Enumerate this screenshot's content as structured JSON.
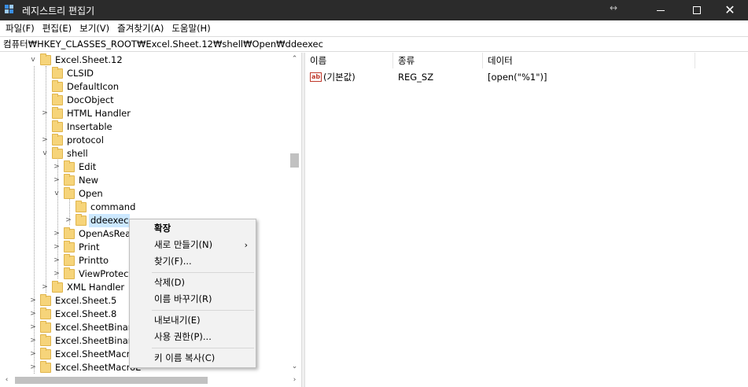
{
  "window": {
    "title": "레지스트리 편집기",
    "resize_glyph": "↔",
    "close_glyph": "✕"
  },
  "menubar": {
    "items": [
      "파일(F)",
      "편집(E)",
      "보기(V)",
      "즐겨찾기(A)",
      "도움말(H)"
    ]
  },
  "address": {
    "path": "컴퓨터₩HKEY_CLASSES_ROOT₩Excel.Sheet.12₩shell₩Open₩ddeexec"
  },
  "tree": {
    "chev_expanded": "v",
    "chev_collapsed": ">",
    "nodes": [
      {
        "label": "Excel.Sheet.12",
        "state": "expanded"
      },
      {
        "label": "CLSID",
        "state": "leaf"
      },
      {
        "label": "DefaultIcon",
        "state": "leaf"
      },
      {
        "label": "DocObject",
        "state": "leaf"
      },
      {
        "label": "HTML Handler",
        "state": "collapsed"
      },
      {
        "label": "Insertable",
        "state": "leaf"
      },
      {
        "label": "protocol",
        "state": "collapsed"
      },
      {
        "label": "shell",
        "state": "expanded"
      },
      {
        "label": "Edit",
        "state": "collapsed"
      },
      {
        "label": "New",
        "state": "collapsed"
      },
      {
        "label": "Open",
        "state": "expanded"
      },
      {
        "label": "command",
        "state": "leaf"
      },
      {
        "label": "ddeexec",
        "state": "collapsed",
        "selected": true
      },
      {
        "label": "OpenAsRead",
        "state": "collapsed"
      },
      {
        "label": "Print",
        "state": "collapsed"
      },
      {
        "label": "Printto",
        "state": "collapsed"
      },
      {
        "label": "ViewProtecte",
        "state": "collapsed"
      },
      {
        "label": "XML Handler",
        "state": "collapsed"
      },
      {
        "label": "Excel.Sheet.5",
        "state": "collapsed"
      },
      {
        "label": "Excel.Sheet.8",
        "state": "collapsed"
      },
      {
        "label": "Excel.SheetBinaryN",
        "state": "collapsed"
      },
      {
        "label": "Excel.SheetBinaryN",
        "state": "collapsed"
      },
      {
        "label": "Excel.SheetMacroE",
        "state": "collapsed"
      },
      {
        "label": "Excel.SheetMacroE",
        "state": "collapsed"
      }
    ]
  },
  "list": {
    "headers": [
      "이름",
      "종류",
      "데이터"
    ],
    "rows": [
      {
        "icon": "ab",
        "name": "(기본값)",
        "type": "REG_SZ",
        "data": "[open(\"%1\")]"
      }
    ]
  },
  "context_menu": {
    "items": [
      {
        "label": "확장",
        "bold": true
      },
      {
        "label": "새로 만들기(N)",
        "submenu": true,
        "arrow": "›"
      },
      {
        "label": "찾기(F)..."
      },
      {
        "label": "삭제(D)"
      },
      {
        "label": "이름 바꾸기(R)"
      },
      {
        "label": "내보내기(E)"
      },
      {
        "label": "사용 권한(P)..."
      },
      {
        "label": "키 이름 복사(C)"
      }
    ]
  },
  "icons": {
    "app": "registry-editor-icon",
    "folder": "folder-icon",
    "string_value": "string-value-icon"
  },
  "colors": {
    "titlebar": "#2b2b2b",
    "selection": "#cce8ff",
    "folder": "#f6d47a"
  }
}
